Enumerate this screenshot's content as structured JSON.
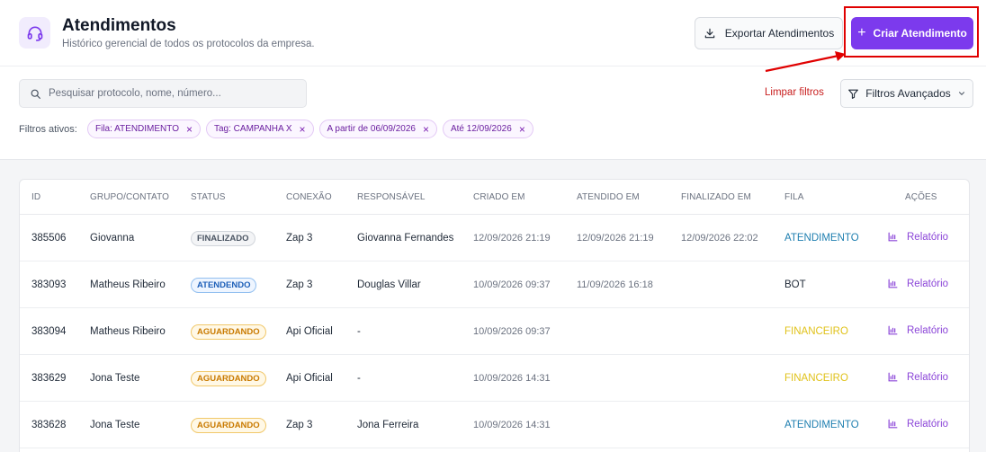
{
  "header": {
    "icon": "headset-icon",
    "title": "Atendimentos",
    "subtitle": "Histórico gerencial de todos os protocolos da empresa.",
    "export_label": "Exportar Atendimentos",
    "create_label": "Criar Atendimento"
  },
  "filters": {
    "search_placeholder": "Pesquisar protocolo, nome, número...",
    "clear_label": "Limpar filtros",
    "advanced_label": "Filtros Avançados",
    "active_label": "Filtros ativos:",
    "chips": [
      "Fila: ATENDIMENTO",
      "Tag: CAMPANHA X",
      "A partir de 06/09/2026",
      "Até 12/09/2026"
    ]
  },
  "table": {
    "columns": [
      "ID",
      "GRUPO/CONTATO",
      "STATUS",
      "CONEXÃO",
      "RESPONSÁVEL",
      "CRIADO EM",
      "ATENDIDO EM",
      "FINALIZADO EM",
      "FILA",
      "AÇÕES"
    ],
    "rows": [
      {
        "id": "385506",
        "contact": "Giovanna",
        "status": "FINALIZADO",
        "status_kind": "finalizado",
        "connection": "Zap 3",
        "responsible": "Giovanna Fernandes",
        "created": "12/09/2026 21:19",
        "attended": "12/09/2026 21:19",
        "finished": "12/09/2026 22:02",
        "queue": "ATENDIMENTO",
        "queue_color": "#1f7fb0",
        "action": "Relatório"
      },
      {
        "id": "383093",
        "contact": "Matheus Ribeiro",
        "status": "ATENDENDO",
        "status_kind": "atendendo",
        "connection": "Zap 3",
        "responsible": "Douglas Villar",
        "created": "10/09/2026 09:37",
        "attended": "11/09/2026 16:18",
        "finished": "",
        "queue": "BOT",
        "queue_color": "#1f2937",
        "action": "Relatório"
      },
      {
        "id": "383094",
        "contact": "Matheus Ribeiro",
        "status": "AGUARDANDO",
        "status_kind": "aguardando",
        "connection": "Api Oficial",
        "responsible": "-",
        "created": "10/09/2026 09:37",
        "attended": "",
        "finished": "",
        "queue": "FINANCEIRO",
        "queue_color": "#e0c21a",
        "action": "Relatório"
      },
      {
        "id": "383629",
        "contact": "Jona Teste",
        "status": "AGUARDANDO",
        "status_kind": "aguardando",
        "connection": "Api Oficial",
        "responsible": "-",
        "created": "10/09/2026 14:31",
        "attended": "",
        "finished": "",
        "queue": "FINANCEIRO",
        "queue_color": "#e0c21a",
        "action": "Relatório"
      },
      {
        "id": "383628",
        "contact": "Jona Teste",
        "status": "AGUARDANDO",
        "status_kind": "aguardando",
        "connection": "Zap 3",
        "responsible": "Jona Ferreira",
        "created": "10/09/2026 14:31",
        "attended": "",
        "finished": "",
        "queue": "ATENDIMENTO",
        "queue_color": "#1f7fb0",
        "action": "Relatório"
      }
    ]
  },
  "colors": {
    "primary": "#7c3aed",
    "danger": "#c81e1e",
    "annotation": "#e00000"
  }
}
